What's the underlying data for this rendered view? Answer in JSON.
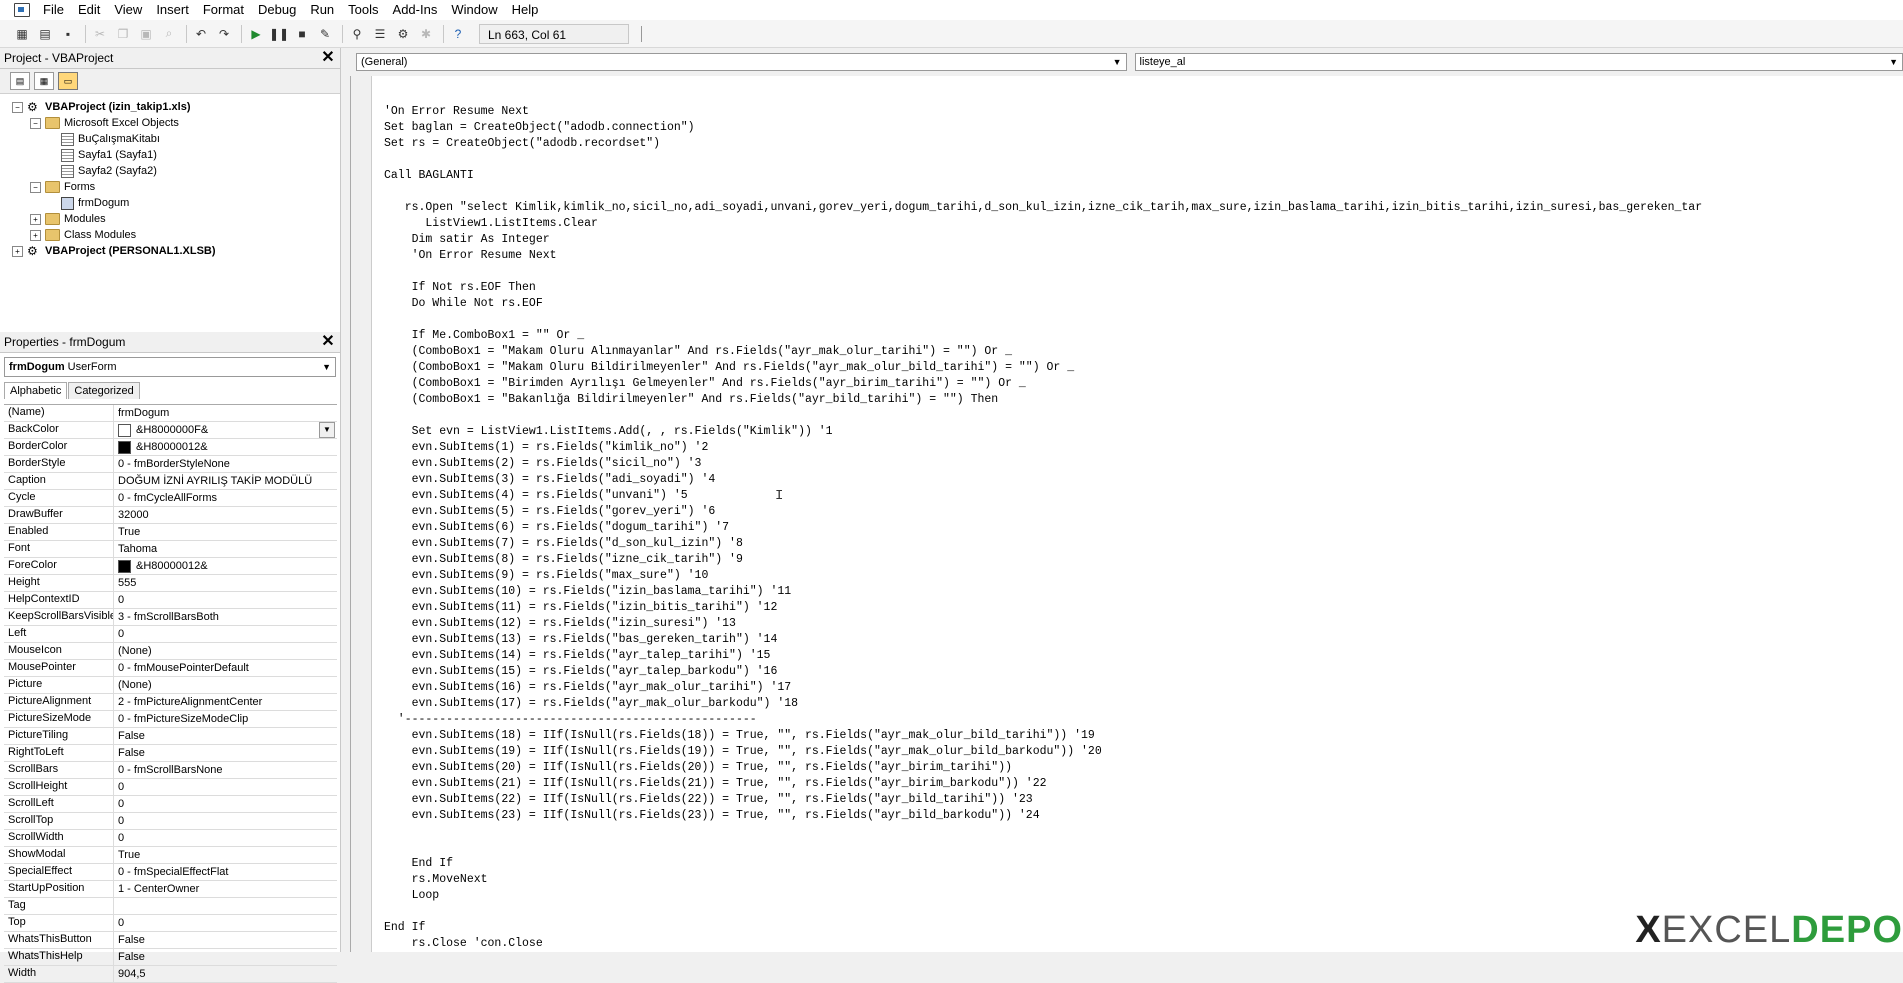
{
  "menu": [
    "File",
    "Edit",
    "View",
    "Insert",
    "Format",
    "Debug",
    "Run",
    "Tools",
    "Add-Ins",
    "Window",
    "Help"
  ],
  "toolbar": {
    "position": "Ln 663, Col 61"
  },
  "project_pane": {
    "title": "Project - VBAProject",
    "tree": [
      {
        "label": "VBAProject (izin_takip1.xls)",
        "level": 0,
        "icon": "project-icon",
        "bold": true,
        "expander": "−"
      },
      {
        "label": "Microsoft Excel Objects",
        "level": 1,
        "icon": "folder-icon",
        "expander": "−"
      },
      {
        "label": "BuÇalışmaKitabı",
        "level": 2,
        "icon": "sheet-icon"
      },
      {
        "label": "Sayfa1 (Sayfa1)",
        "level": 2,
        "icon": "sheet-icon"
      },
      {
        "label": "Sayfa2 (Sayfa2)",
        "level": 2,
        "icon": "sheet-icon"
      },
      {
        "label": "Forms",
        "level": 1,
        "icon": "folder-icon",
        "expander": "−"
      },
      {
        "label": "frmDogum",
        "level": 2,
        "icon": "form-icon"
      },
      {
        "label": "Modules",
        "level": 1,
        "icon": "folder-icon",
        "expander": "+"
      },
      {
        "label": "Class Modules",
        "level": 1,
        "icon": "folder-icon",
        "expander": "+"
      },
      {
        "label": "VBAProject (PERSONAL1.XLSB)",
        "level": 0,
        "icon": "project-icon",
        "bold": true,
        "expander": "+"
      }
    ]
  },
  "properties_pane": {
    "title": "Properties - frmDogum",
    "object_name": "frmDogum",
    "object_type": "UserForm",
    "tabs": [
      "Alphabetic",
      "Categorized"
    ],
    "rows": [
      {
        "name": "(Name)",
        "value": "frmDogum"
      },
      {
        "name": "BackColor",
        "value": "&H8000000F&",
        "swatch": "#ffffff",
        "dropdown": true
      },
      {
        "name": "BorderColor",
        "value": "&H80000012&",
        "swatch": "#000000"
      },
      {
        "name": "BorderStyle",
        "value": "0 - fmBorderStyleNone"
      },
      {
        "name": "Caption",
        "value": "DOĞUM İZNİ AYRILIŞ TAKİP MODÜLÜ"
      },
      {
        "name": "Cycle",
        "value": "0 - fmCycleAllForms"
      },
      {
        "name": "DrawBuffer",
        "value": "32000"
      },
      {
        "name": "Enabled",
        "value": "True"
      },
      {
        "name": "Font",
        "value": "Tahoma"
      },
      {
        "name": "ForeColor",
        "value": "&H80000012&",
        "swatch": "#000000"
      },
      {
        "name": "Height",
        "value": "555"
      },
      {
        "name": "HelpContextID",
        "value": "0"
      },
      {
        "name": "KeepScrollBarsVisible",
        "value": "3 - fmScrollBarsBoth"
      },
      {
        "name": "Left",
        "value": "0"
      },
      {
        "name": "MouseIcon",
        "value": "(None)"
      },
      {
        "name": "MousePointer",
        "value": "0 - fmMousePointerDefault"
      },
      {
        "name": "Picture",
        "value": "(None)"
      },
      {
        "name": "PictureAlignment",
        "value": "2 - fmPictureAlignmentCenter"
      },
      {
        "name": "PictureSizeMode",
        "value": "0 - fmPictureSizeModeClip"
      },
      {
        "name": "PictureTiling",
        "value": "False"
      },
      {
        "name": "RightToLeft",
        "value": "False"
      },
      {
        "name": "ScrollBars",
        "value": "0 - fmScrollBarsNone"
      },
      {
        "name": "ScrollHeight",
        "value": "0"
      },
      {
        "name": "ScrollLeft",
        "value": "0"
      },
      {
        "name": "ScrollTop",
        "value": "0"
      },
      {
        "name": "ScrollWidth",
        "value": "0"
      },
      {
        "name": "ShowModal",
        "value": "True"
      },
      {
        "name": "SpecialEffect",
        "value": "0 - fmSpecialEffectFlat"
      },
      {
        "name": "StartUpPosition",
        "value": "1 - CenterOwner"
      },
      {
        "name": "Tag",
        "value": ""
      },
      {
        "name": "Top",
        "value": "0"
      },
      {
        "name": "WhatsThisButton",
        "value": "False"
      },
      {
        "name": "WhatsThisHelp",
        "value": "False"
      },
      {
        "name": "Width",
        "value": "904,5"
      }
    ]
  },
  "code_pane": {
    "object_combo": "(General)",
    "procedure_combo": "listeye_al",
    "lines": [
      "'On Error Resume Next",
      "Set baglan = CreateObject(\"adodb.connection\")",
      "Set rs = CreateObject(\"adodb.recordset\")",
      "",
      "Call BAGLANTI",
      "",
      "   rs.Open \"select Kimlik,kimlik_no,sicil_no,adi_soyadi,unvani,gorev_yeri,dogum_tarihi,d_son_kul_izin,izne_cik_tarih,max_sure,izin_baslama_tarihi,izin_bitis_tarihi,izin_suresi,bas_gereken_tar",
      "      ListView1.ListItems.Clear",
      "    Dim satir As Integer",
      "    'On Error Resume Next",
      "",
      "    If Not rs.EOF Then",
      "    Do While Not rs.EOF",
      "",
      "    If Me.ComboBox1 = \"\" Or _",
      "    (ComboBox1 = \"Makam Oluru Alınmayanlar\" And rs.Fields(\"ayr_mak_olur_tarihi\") = \"\") Or _",
      "    (ComboBox1 = \"Makam Oluru Bildirilmeyenler\" And rs.Fields(\"ayr_mak_olur_bild_tarihi\") = \"\") Or _",
      "    (ComboBox1 = \"Birimden Ayrılışı Gelmeyenler\" And rs.Fields(\"ayr_birim_tarihi\") = \"\") Or _",
      "    (ComboBox1 = \"Bakanlığa Bildirilmeyenler\" And rs.Fields(\"ayr_bild_tarihi\") = \"\") Then",
      "",
      "    Set evn = ListView1.ListItems.Add(, , rs.Fields(\"Kimlik\")) '1",
      "    evn.SubItems(1) = rs.Fields(\"kimlik_no\") '2",
      "    evn.SubItems(2) = rs.Fields(\"sicil_no\") '3",
      "    evn.SubItems(3) = rs.Fields(\"adi_soyadi\") '4",
      "    evn.SubItems(4) = rs.Fields(\"unvani\") '5",
      "    evn.SubItems(5) = rs.Fields(\"gorev_yeri\") '6",
      "    evn.SubItems(6) = rs.Fields(\"dogum_tarihi\") '7",
      "    evn.SubItems(7) = rs.Fields(\"d_son_kul_izin\") '8",
      "    evn.SubItems(8) = rs.Fields(\"izne_cik_tarih\") '9",
      "    evn.SubItems(9) = rs.Fields(\"max_sure\") '10",
      "    evn.SubItems(10) = rs.Fields(\"izin_baslama_tarihi\") '11",
      "    evn.SubItems(11) = rs.Fields(\"izin_bitis_tarihi\") '12",
      "    evn.SubItems(12) = rs.Fields(\"izin_suresi\") '13",
      "    evn.SubItems(13) = rs.Fields(\"bas_gereken_tarih\") '14",
      "    evn.SubItems(14) = rs.Fields(\"ayr_talep_tarihi\") '15",
      "    evn.SubItems(15) = rs.Fields(\"ayr_talep_barkodu\") '16",
      "    evn.SubItems(16) = rs.Fields(\"ayr_mak_olur_tarihi\") '17",
      "    evn.SubItems(17) = rs.Fields(\"ayr_mak_olur_barkodu\") '18",
      "  '---------------------------------------------------",
      "    evn.SubItems(18) = IIf(IsNull(rs.Fields(18)) = True, \"\", rs.Fields(\"ayr_mak_olur_bild_tarihi\")) '19",
      "    evn.SubItems(19) = IIf(IsNull(rs.Fields(19)) = True, \"\", rs.Fields(\"ayr_mak_olur_bild_barkodu\")) '20",
      "    evn.SubItems(20) = IIf(IsNull(rs.Fields(20)) = True, \"\", rs.Fields(\"ayr_birim_tarihi\"))",
      "    evn.SubItems(21) = IIf(IsNull(rs.Fields(21)) = True, \"\", rs.Fields(\"ayr_birim_barkodu\")) '22",
      "    evn.SubItems(22) = IIf(IsNull(rs.Fields(22)) = True, \"\", rs.Fields(\"ayr_bild_tarihi\")) '23",
      "    evn.SubItems(23) = IIf(IsNull(rs.Fields(23)) = True, \"\", rs.Fields(\"ayr_bild_barkodu\")) '24",
      "",
      "",
      "    End If",
      "    rs.MoveNext",
      "    Loop",
      "",
      "End If",
      "    rs.Close 'con.Close"
    ]
  },
  "watermark": {
    "part1": "X",
    "part2": "EXCEL",
    "part3": "DEPO"
  },
  "colors": {
    "accent_green": "#2e9c3c",
    "window_bg": "#f0f0f0"
  }
}
